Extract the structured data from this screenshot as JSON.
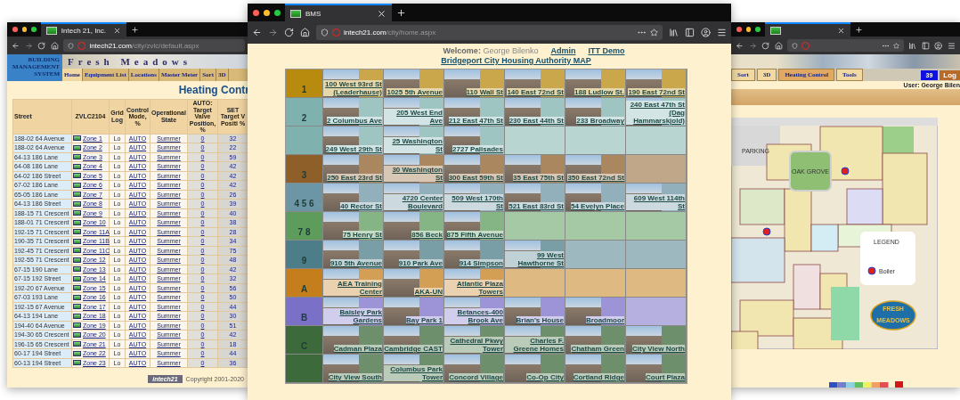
{
  "left_window": {
    "tab_title": "Intech 21, Inc.",
    "url_host": "intech21.com",
    "url_path": "/city/zvlc/default.aspx",
    "brand": "BUILDING MANAGEMENT SYSTEM",
    "banner": "Fresh Meadows",
    "nav": [
      {
        "label": "Home",
        "selected": true
      },
      {
        "label": "Equipment List",
        "selected": false
      },
      {
        "label": "Locations",
        "selected": false
      },
      {
        "label": "Master Meter",
        "selected": false
      },
      {
        "label": "Sort",
        "selected": false
      },
      {
        "label": "3D",
        "selected": false
      }
    ],
    "title": "Heating Contr",
    "table": {
      "columns": [
        {
          "label": "Street"
        },
        {
          "label": "ZVLC2104"
        },
        {
          "label": "Grid Log"
        },
        {
          "label": "Control Mode, %"
        },
        {
          "label": "Operational State"
        },
        {
          "group": "AUTO:",
          "label": "Target Valve Position, %"
        },
        {
          "group": "SET",
          "label": "Target V Positi %"
        }
      ],
      "rows": [
        {
          "street": "188-02 64 Avenue",
          "zone": "Zone 1",
          "log": "Lo",
          "mode": "AUTO",
          "state": "Summer",
          "valve": "0",
          "target": "32"
        },
        {
          "street": "188-02 64 Avenue",
          "zone": "Zone 2",
          "log": "Lo",
          "mode": "AUTO",
          "state": "Summer",
          "valve": "0",
          "target": "22"
        },
        {
          "street": "64-13 186 Lane",
          "zone": "Zone 3",
          "log": "Lo",
          "mode": "AUTO",
          "state": "Summer",
          "valve": "0",
          "target": "59"
        },
        {
          "street": "64-08 186 Lane",
          "zone": "Zone 4",
          "log": "Lo",
          "mode": "AUTO",
          "state": "Summer",
          "valve": "0",
          "target": "42"
        },
        {
          "street": "64-02 186 Street",
          "zone": "Zone 5",
          "log": "Lo",
          "mode": "AUTO",
          "state": "Summer",
          "valve": "0",
          "target": "42"
        },
        {
          "street": "67-02 186 Lane",
          "zone": "Zone 6",
          "log": "Lo",
          "mode": "AUTO",
          "state": "Summer",
          "valve": "0",
          "target": "42"
        },
        {
          "street": "65-05 186 Lane",
          "zone": "Zone 7",
          "log": "Lo",
          "mode": "AUTO",
          "state": "Summer",
          "valve": "0",
          "target": "26"
        },
        {
          "street": "64-13 186 Street",
          "zone": "Zone 8",
          "log": "Lo",
          "mode": "AUTO",
          "state": "Summer",
          "valve": "0",
          "target": "39"
        },
        {
          "street": "188-15 71 Crescent",
          "zone": "Zone 9",
          "log": "Lo",
          "mode": "AUTO",
          "state": "Summer",
          "valve": "0",
          "target": "40"
        },
        {
          "street": "188-01 71 Crescent",
          "zone": "Zone 10",
          "log": "Lo",
          "mode": "AUTO",
          "state": "Summer",
          "valve": "0",
          "target": "38"
        },
        {
          "street": "192-15 71 Crescent",
          "zone": "Zone 11A",
          "log": "Lo",
          "mode": "AUTO",
          "state": "Summer",
          "valve": "0",
          "target": "28"
        },
        {
          "street": "190-35 71 Crescent",
          "zone": "Zone 11B",
          "log": "Lo",
          "mode": "AUTO",
          "state": "Summer",
          "valve": "0",
          "target": "34"
        },
        {
          "street": "192-45 71 Crescent",
          "zone": "Zone 11C",
          "log": "Lo",
          "mode": "AUTO",
          "state": "Summer",
          "valve": "0",
          "target": "75"
        },
        {
          "street": "192-55 71 Crescent",
          "zone": "Zone 12",
          "log": "Lo",
          "mode": "AUTO",
          "state": "Summer",
          "valve": "0",
          "target": "48"
        },
        {
          "street": "67-15 190 Lane",
          "zone": "Zone 13",
          "log": "Lo",
          "mode": "AUTO",
          "state": "Summer",
          "valve": "0",
          "target": "42"
        },
        {
          "street": "67-15 192 Street",
          "zone": "Zone 14",
          "log": "Lo",
          "mode": "AUTO",
          "state": "Summer",
          "valve": "0",
          "target": "32"
        },
        {
          "street": "192-20 67 Avenue",
          "zone": "Zone 15",
          "log": "Lo",
          "mode": "AUTO",
          "state": "Summer",
          "valve": "0",
          "target": "56"
        },
        {
          "street": "67-03 193 Lane",
          "zone": "Zone 16",
          "log": "Lo",
          "mode": "AUTO",
          "state": "Summer",
          "valve": "0",
          "target": "50"
        },
        {
          "street": "192-15 67 Avenue",
          "zone": "Zone 17",
          "log": "Lo",
          "mode": "AUTO",
          "state": "Summer",
          "valve": "0",
          "target": "44"
        },
        {
          "street": "64-13 194 Lane",
          "zone": "Zone 18",
          "log": "Lo",
          "mode": "AUTO",
          "state": "Summer",
          "valve": "0",
          "target": "30"
        },
        {
          "street": "194-40 64 Avenue",
          "zone": "Zone 19",
          "log": "Lo",
          "mode": "AUTO",
          "state": "Summer",
          "valve": "0",
          "target": "51"
        },
        {
          "street": "194-30 65 Crescent",
          "zone": "Zone 20",
          "log": "Lo",
          "mode": "AUTO",
          "state": "Summer",
          "valve": "0",
          "target": "42"
        },
        {
          "street": "196-15 65 Crescent",
          "zone": "Zone 21",
          "log": "Lo",
          "mode": "AUTO",
          "state": "Summer",
          "valve": "0",
          "target": "18"
        },
        {
          "street": "60-17 194 Street",
          "zone": "Zone 22",
          "log": "Lo",
          "mode": "AUTO",
          "state": "Summer",
          "valve": "0",
          "target": "44"
        },
        {
          "street": "60-13 194 Street",
          "zone": "Zone 23",
          "log": "Lo",
          "mode": "AUTO",
          "state": "Summer",
          "valve": "0",
          "target": "36"
        }
      ]
    },
    "footer_logo": "intech21",
    "copyright": "Copyright 2001-2020"
  },
  "main_window": {
    "tab_title": "BMS",
    "url_host": "intech21.com",
    "url_path": "/city/home.aspx",
    "welcome_label": "Welcome:",
    "user": "George Bilenko",
    "links": [
      "Admin",
      "ITT Demo"
    ],
    "map_link": "Bridgeport City Housing Authority MAP",
    "rows": [
      {
        "label": "1",
        "color": "#b88a0e",
        "cells": [
          {
            "kind": "building",
            "name": "100 West 93rd St (Leaderhause)"
          },
          {
            "kind": "building",
            "name": "1025 5th Avenue"
          },
          {
            "kind": "building",
            "name": "110 Wall St"
          },
          {
            "kind": "building",
            "name": "140 East 72nd St"
          },
          {
            "kind": "building",
            "name": "188 Ludlow St."
          },
          {
            "kind": "building",
            "name": "190 East 72nd St"
          }
        ]
      },
      {
        "label": "2",
        "color": "#7fb2ae",
        "cells": [
          {
            "kind": "building",
            "name": "2 Columbus Ave"
          },
          {
            "kind": "building",
            "name": "205 West End Ave"
          },
          {
            "kind": "building",
            "name": "212 East 47th St"
          },
          {
            "kind": "building",
            "name": "230 East 44th St"
          },
          {
            "kind": "building",
            "name": "233 Broadway"
          },
          {
            "kind": "building",
            "name": "240 East 47th St (Dag Hammarskjold)"
          }
        ]
      },
      {
        "color": "#7fb2ae",
        "cells": [
          {
            "kind": "building",
            "name": "249 West 29th St"
          },
          {
            "kind": "building",
            "name": "25 Washington St"
          },
          {
            "kind": "building",
            "name": "2727 Palisades"
          },
          {
            "kind": "empty"
          },
          {
            "kind": "empty"
          },
          {
            "kind": "empty"
          }
        ]
      },
      {
        "label": "3",
        "color": "#8e5f28",
        "cells": [
          {
            "kind": "building",
            "name": "250 East 23rd St"
          },
          {
            "kind": "building",
            "name": "30 Washington St"
          },
          {
            "kind": "building",
            "name": "300 East 59th St"
          },
          {
            "kind": "building",
            "name": "35 East 75th St"
          },
          {
            "kind": "building",
            "name": "350 East 72nd St"
          },
          {
            "kind": "empty"
          }
        ]
      },
      {
        "label": "4 5 6",
        "color": "#6c96a6",
        "cells": [
          {
            "kind": "building",
            "name": "40 Rector St"
          },
          {
            "kind": "building",
            "name": "4720 Center Boulevard"
          },
          {
            "kind": "building",
            "name": "509 West 170th St"
          },
          {
            "kind": "building",
            "name": "521 East 83rd St"
          },
          {
            "kind": "building",
            "name": "54 Evelyn Place"
          },
          {
            "kind": "building",
            "name": "609 West 114th St"
          }
        ]
      },
      {
        "label": "7 8",
        "color": "#5e9c5c",
        "cells": [
          {
            "kind": "building",
            "name": "75 Henry St"
          },
          {
            "kind": "building",
            "name": "856 Beck"
          },
          {
            "kind": "building",
            "name": "875 Fifth Avenue"
          },
          {
            "kind": "empty"
          },
          {
            "kind": "empty"
          },
          {
            "kind": "empty"
          }
        ]
      },
      {
        "label": "9",
        "color": "#4c7d88",
        "cells": [
          {
            "kind": "building",
            "name": "910 5th Avenue"
          },
          {
            "kind": "building",
            "name": "910 Park Ave"
          },
          {
            "kind": "building",
            "name": "914 Simpson"
          },
          {
            "kind": "building",
            "name": "99 West Hawthorne St"
          },
          {
            "kind": "empty"
          },
          {
            "kind": "empty"
          }
        ]
      },
      {
        "label": "A",
        "color": "#c47f1c",
        "cells": [
          {
            "kind": "building",
            "name": "AEA Training Center"
          },
          {
            "kind": "building",
            "name": "AKA-UN"
          },
          {
            "kind": "building",
            "name": "Atlantic Plaza Towers"
          },
          {
            "kind": "empty"
          },
          {
            "kind": "empty"
          },
          {
            "kind": "empty"
          }
        ]
      },
      {
        "label": "B",
        "color": "#7b70c8",
        "cells": [
          {
            "kind": "building",
            "name": "Baisley Park Gardens"
          },
          {
            "kind": "building",
            "name": "Bay Park 1"
          },
          {
            "kind": "building",
            "name": "Betances-400 Brook Ave"
          },
          {
            "kind": "building",
            "name": "Brian's House"
          },
          {
            "kind": "building",
            "name": "Broadmoor"
          },
          {
            "kind": "empty"
          }
        ]
      },
      {
        "label": "C",
        "color": "#3d6a3a",
        "cells": [
          {
            "kind": "building",
            "name": "Cadman Plaza"
          },
          {
            "kind": "building",
            "name": "Cambridge CAST"
          },
          {
            "kind": "building",
            "name": "Cathedral Pkwy Tower"
          },
          {
            "kind": "building",
            "name": "Charles F. Greene Homes"
          },
          {
            "kind": "building",
            "name": "Chatham Green"
          },
          {
            "kind": "building",
            "name": "City View North"
          }
        ]
      },
      {
        "color": "#3d6a3a",
        "cells": [
          {
            "kind": "building",
            "name": "City View South"
          },
          {
            "kind": "building",
            "name": "Columbus Park Tower"
          },
          {
            "kind": "building",
            "name": "Concord Village"
          },
          {
            "kind": "building",
            "name": "Co-Op City"
          },
          {
            "kind": "building",
            "name": "Cortland Ridge"
          },
          {
            "kind": "building",
            "name": "Court Plaza"
          }
        ]
      }
    ]
  },
  "right_window": {
    "nav": [
      {
        "label": "Sort",
        "selected": false
      },
      {
        "label": "3D",
        "selected": false
      },
      {
        "label": "Heating Control",
        "selected": true
      },
      {
        "label": "Tools",
        "selected": false
      }
    ],
    "badge": "39",
    "logout": "Log",
    "user": "User: George Bilen",
    "map": {
      "parking": "PARKING",
      "grove": "OAK GROVE",
      "legend_title": "LEGEND",
      "legend_item": "Boiler",
      "logo_lines": [
        "FRESH",
        "MEADOWS"
      ]
    }
  }
}
